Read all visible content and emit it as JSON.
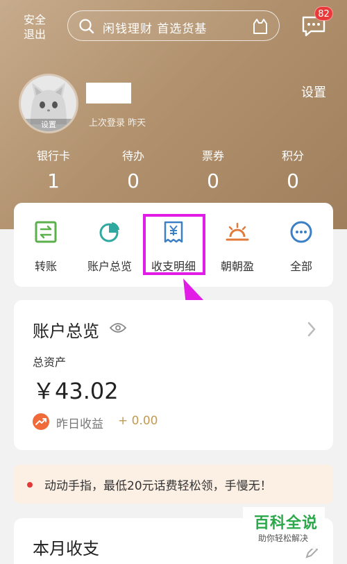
{
  "top_bar": {
    "logout_label": "安全\n退出",
    "search_placeholder": "闲钱理财 首选货基",
    "message_badge": "82"
  },
  "profile": {
    "avatar_label": "设置",
    "last_login": "上次登录 昨天",
    "settings_label": "设置"
  },
  "stats": [
    {
      "label": "银行卡",
      "value": "1"
    },
    {
      "label": "待办",
      "value": "0"
    },
    {
      "label": "票券",
      "value": "0"
    },
    {
      "label": "积分",
      "value": "0"
    }
  ],
  "quick_actions": [
    {
      "label": "转账",
      "icon": "transfer-icon"
    },
    {
      "label": "账户总览",
      "icon": "pie-chart-icon"
    },
    {
      "label": "收支明细",
      "icon": "receipt-icon"
    },
    {
      "label": "朝朝盈",
      "icon": "sunrise-icon"
    },
    {
      "label": "全部",
      "icon": "more-icon"
    }
  ],
  "account_overview": {
    "title": "账户总览",
    "total_label": "总资产",
    "total_value": "￥43.02",
    "yield_label": "昨日收益",
    "yield_value": "+ 0.00"
  },
  "notice": {
    "text": "动动手指，最低20元话费轻松领，手慢无！"
  },
  "monthly": {
    "title": "本月收支"
  },
  "watermark": {
    "title": "百科全说",
    "subtitle": "助你轻松解决"
  },
  "colors": {
    "header_gold": "#b2926e",
    "highlight": "#e01ce6",
    "badge_red": "#e93a3a",
    "yield_gold": "#c39a52",
    "watermark_green": "#2aa84a"
  }
}
